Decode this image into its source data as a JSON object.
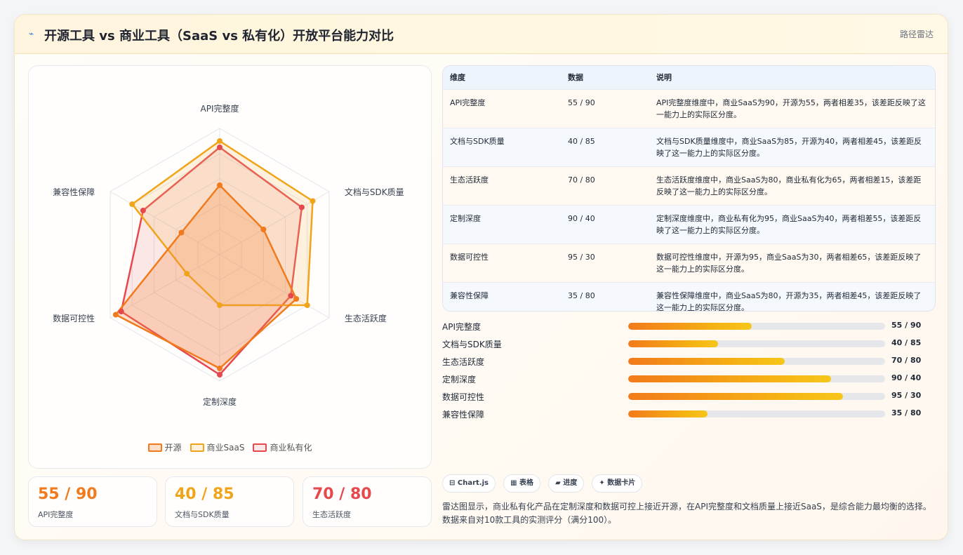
{
  "header": {
    "icon": "chart-line-icon",
    "title": "开源工具 vs 商业工具（SaaS vs 私有化）开放平台能力对比",
    "tag": "路径雷达"
  },
  "chart_data": {
    "type": "radar",
    "axes": [
      "API完整度",
      "文档与SDK质量",
      "生态活跃度",
      "定制深度",
      "数据可控性",
      "兼容性保障"
    ],
    "range": [
      0,
      100
    ],
    "rings": 5,
    "series": [
      {
        "name": "开源",
        "values": [
          55,
          40,
          70,
          90,
          95,
          35
        ],
        "color": "#f07a1c",
        "fill": "rgba(245,140,70,0.28)"
      },
      {
        "name": "商业SaaS",
        "values": [
          90,
          85,
          80,
          40,
          30,
          80
        ],
        "color": "#f0a419",
        "fill": "rgba(246,190,110,0.22)"
      },
      {
        "name": "商业私有化",
        "values": [
          85,
          75,
          65,
          95,
          90,
          70
        ],
        "color": "#e5484d",
        "fill": "rgba(232,110,115,0.16)"
      }
    ]
  },
  "kpis": [
    {
      "value": "55 / 90",
      "label": "API完整度",
      "color": "#f07a1c"
    },
    {
      "value": "40 / 85",
      "label": "文档与SDK质量",
      "color": "#f0a419"
    },
    {
      "value": "70 / 80",
      "label": "生态活跃度",
      "color": "#e5484d"
    }
  ],
  "table": {
    "headers": [
      "维度",
      "数据",
      "说明"
    ],
    "rows": [
      [
        "API完整度",
        "55 / 90",
        "API完整度维度中，商业SaaS为90，开源为55，两者相差35，该差距反映了这一能力上的实际区分度。"
      ],
      [
        "文档与SDK质量",
        "40 / 85",
        "文档与SDK质量维度中，商业SaaS为85，开源为40，两者相差45，该差距反映了这一能力上的实际区分度。"
      ],
      [
        "生态活跃度",
        "70 / 80",
        "生态活跃度维度中，商业SaaS为80，商业私有化为65，两者相差15，该差距反映了这一能力上的实际区分度。"
      ],
      [
        "定制深度",
        "90 / 40",
        "定制深度维度中，商业私有化为95，商业SaaS为40，两者相差55，该差距反映了这一能力上的实际区分度。"
      ],
      [
        "数据可控性",
        "95 / 30",
        "数据可控性维度中，开源为95，商业SaaS为30，两者相差65，该差距反映了这一能力上的实际区分度。"
      ],
      [
        "兼容性保障",
        "35 / 80",
        "兼容性保障维度中，商业SaaS为80，开源为35，两者相差45，该差距反映了这一能力上的实际区分度。"
      ]
    ]
  },
  "progress": [
    {
      "label": "API完整度",
      "value": "55 / 90",
      "fill": 0.48
    },
    {
      "label": "文档与SDK质量",
      "value": "40 / 85",
      "fill": 0.35
    },
    {
      "label": "生态活跃度",
      "value": "70 / 80",
      "fill": 0.61
    },
    {
      "label": "定制深度",
      "value": "90 / 40",
      "fill": 0.79
    },
    {
      "label": "数据可控性",
      "value": "95 / 30",
      "fill": 0.836
    },
    {
      "label": "兼容性保障",
      "value": "35 / 80",
      "fill": 0.31
    }
  ],
  "chips": [
    "⊟ Chart.js",
    "▦ 表格",
    "▰ 进度",
    "✦ 数据卡片"
  ],
  "note": "雷达图显示，商业私有化产品在定制深度和数据可控上接近开源，在API完整度和文档质量上接近SaaS，是综合能力最均衡的选择。数据来自对10款工具的实测评分（满分100）。"
}
